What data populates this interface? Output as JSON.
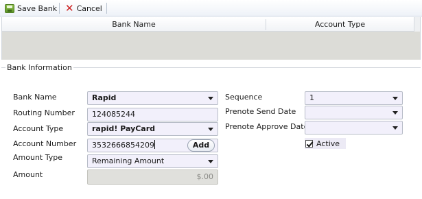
{
  "toolbar": {
    "save_label": "Save Bank",
    "cancel_label": "Cancel"
  },
  "grid": {
    "columns": [
      "Bank Name",
      "Account Type"
    ]
  },
  "section": {
    "legend": "Bank Information"
  },
  "form": {
    "bank_name": {
      "label": "Bank Name",
      "value": "Rapid"
    },
    "routing_number": {
      "label": "Routing Number",
      "value": "124085244"
    },
    "account_type": {
      "label": "Account Type",
      "value": "rapid! PayCard"
    },
    "account_number": {
      "label": "Account Number",
      "value": "3532666854209",
      "add_label": "Add"
    },
    "amount_type": {
      "label": "Amount Type",
      "value": "Remaining Amount"
    },
    "amount": {
      "label": "Amount",
      "value": "$.00"
    },
    "sequence": {
      "label": "Sequence",
      "value": "1"
    },
    "prenote_send_date": {
      "label": "Prenote Send Date",
      "value": ""
    },
    "prenote_approve_date": {
      "label": "Prenote Approve Date",
      "value": ""
    },
    "active": {
      "label": "Active",
      "checked": true
    }
  },
  "icons": {
    "save": "save-icon",
    "cancel": "cancel-icon",
    "dropdown": "chevron-down-icon"
  },
  "colors": {
    "input_bg": "#f2f0fb",
    "grid_body_bg": "#dcdcd7",
    "cancel_red": "#cc1f1f"
  }
}
